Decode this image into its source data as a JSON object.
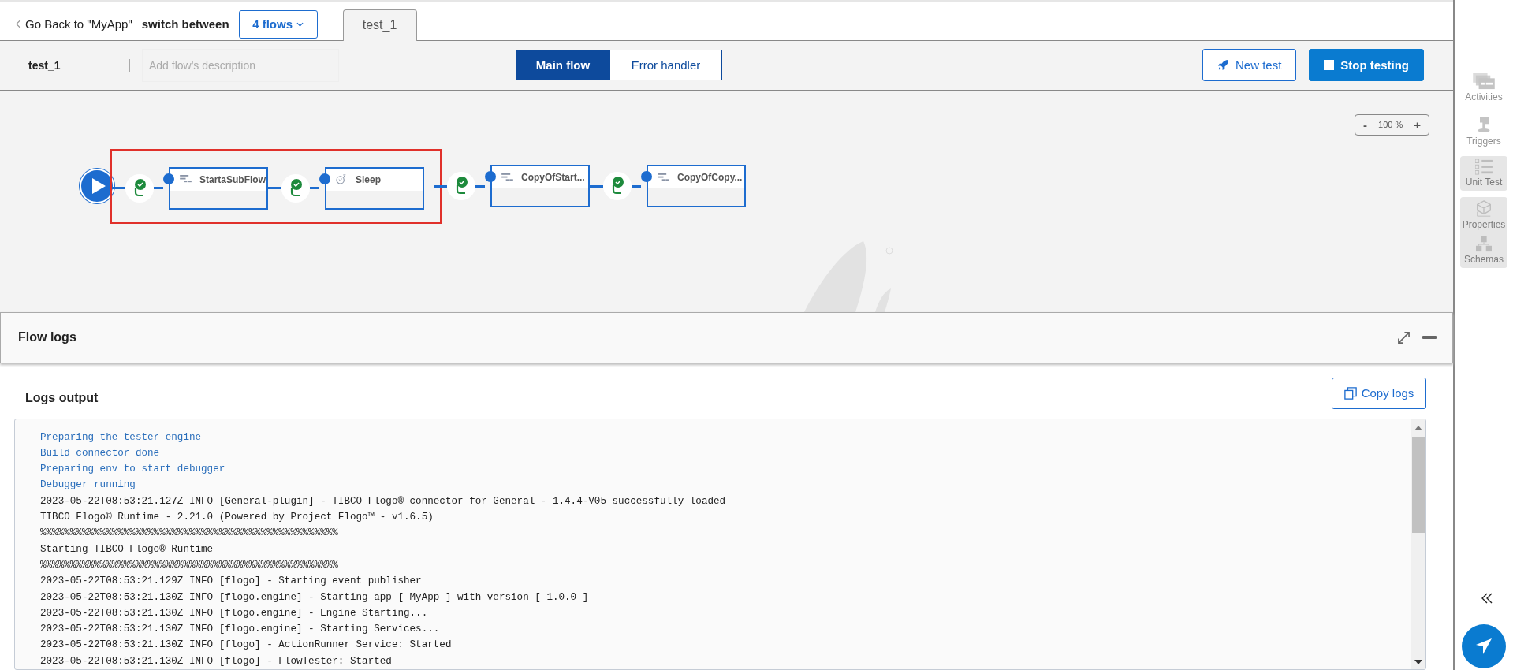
{
  "topbar": {
    "back_link": "Go Back to \"MyApp\"",
    "switch_label": "switch between",
    "flows_button": "4 flows",
    "tabs": [
      {
        "label": "test_1",
        "selected": true
      }
    ]
  },
  "header": {
    "flow_name": "test_1",
    "description": {
      "placeholder": "Add flow's description"
    },
    "views": [
      {
        "label": "Main flow",
        "selected": true
      },
      {
        "label": "Error handler",
        "selected": false
      }
    ],
    "buttons": [
      {
        "label": "New test",
        "kind": "outline"
      },
      {
        "label": "Stop testing",
        "kind": "primary"
      }
    ]
  },
  "canvas": {
    "zoom": {
      "minus": "-",
      "value": "100 %",
      "plus": "+"
    },
    "nodes": [
      {
        "name": "StartaSubFlow",
        "kind": "subflow",
        "highlighted": true
      },
      {
        "name": "Sleep",
        "kind": "sleep",
        "highlighted": true
      },
      {
        "name": "CopyOfStart...",
        "kind": "subflow",
        "highlighted": false
      },
      {
        "name": "CopyOfCopy...",
        "kind": "subflow",
        "highlighted": false
      }
    ]
  },
  "flow_logs": {
    "title": "Flow logs"
  },
  "logs": {
    "title": "Logs output",
    "copy_button": "Copy logs",
    "lines": [
      {
        "text": "Preparing the tester engine",
        "kind": "status"
      },
      {
        "text": "Build connector done",
        "kind": "status"
      },
      {
        "text": "Preparing env to start debugger",
        "kind": "status"
      },
      {
        "text": "Debugger running",
        "kind": "status"
      },
      {
        "text": "2023-05-22T08:53:21.127Z INFO [General-plugin] - TIBCO Flogo® connector for General - 1.4.4-V05 successfully loaded",
        "kind": "log"
      },
      {
        "text": "TIBCO Flogo® Runtime - 2.21.0 (Powered by Project Flogo™ - v1.6.5)",
        "kind": "log"
      },
      {
        "text": "%%%%%%%%%%%%%%%%%%%%%%%%%%%%%%%%%%%%%%%%%%%%%%%%%%",
        "kind": "log"
      },
      {
        "text": "Starting TIBCO Flogo® Runtime",
        "kind": "log"
      },
      {
        "text": "%%%%%%%%%%%%%%%%%%%%%%%%%%%%%%%%%%%%%%%%%%%%%%%%%%",
        "kind": "log"
      },
      {
        "text": "2023-05-22T08:53:21.129Z INFO [flogo] - Starting event publisher",
        "kind": "log"
      },
      {
        "text": "2023-05-22T08:53:21.130Z INFO [flogo.engine] - Starting app [ MyApp ] with version [ 1.0.0 ]",
        "kind": "log"
      },
      {
        "text": "2023-05-22T08:53:21.130Z INFO [flogo.engine] - Engine Starting...",
        "kind": "log"
      },
      {
        "text": "2023-05-22T08:53:21.130Z INFO [flogo.engine] - Starting Services...",
        "kind": "log"
      },
      {
        "text": "2023-05-22T08:53:21.130Z INFO [flogo] - ActionRunner Service: Started",
        "kind": "log"
      },
      {
        "text": "2023-05-22T08:53:21.130Z INFO [flogo] - FlowTester: Started",
        "kind": "log"
      }
    ]
  },
  "sidebar": {
    "groups": [
      {
        "kind": "plain",
        "items": [
          {
            "label": "Activities",
            "kind": "activities",
            "disabled": true
          }
        ]
      },
      {
        "kind": "plain",
        "items": [
          {
            "label": "Triggers",
            "kind": "triggers",
            "disabled": true
          }
        ]
      },
      {
        "kind": "tile",
        "items": [
          {
            "label": "Unit Test",
            "kind": "unittest",
            "disabled": true
          }
        ]
      },
      {
        "kind": "tile",
        "items": [
          {
            "label": "Properties",
            "kind": "properties",
            "disabled": true
          },
          {
            "label": "Schemas",
            "kind": "schemas",
            "disabled": true
          }
        ]
      }
    ]
  }
}
